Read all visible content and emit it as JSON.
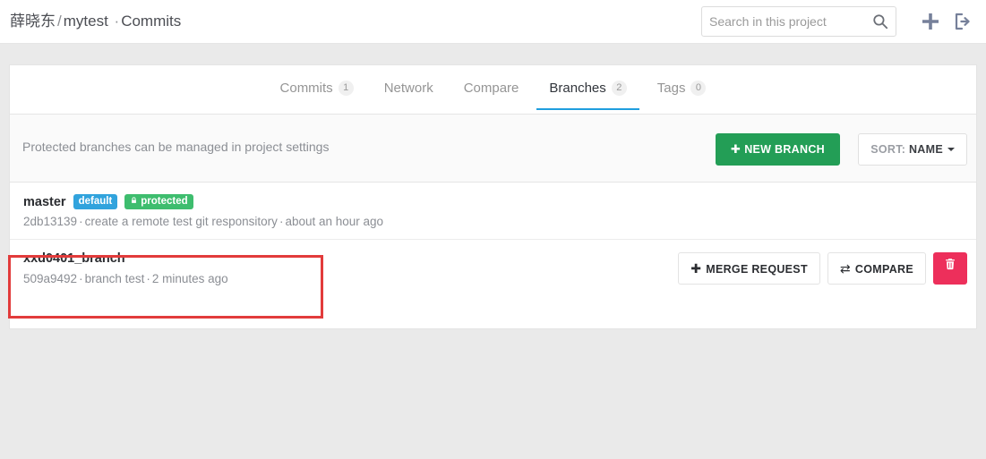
{
  "header": {
    "owner": "薛晓东",
    "separator": "/",
    "project": "mytest",
    "middot": "·",
    "page": "Commits",
    "search": {
      "placeholder": "Search in this project",
      "value": "",
      "icon": "search-icon"
    },
    "icons": {
      "plus": "plus-icon",
      "signout": "sign-out-icon"
    }
  },
  "tabs": [
    {
      "label": "Commits",
      "count": "1",
      "active": false
    },
    {
      "label": "Network",
      "count": "",
      "active": false
    },
    {
      "label": "Compare",
      "count": "",
      "active": false
    },
    {
      "label": "Branches",
      "count": "2",
      "active": true
    },
    {
      "label": "Tags",
      "count": "0",
      "active": false
    }
  ],
  "toolbar": {
    "protected_note_prefix": "Protected branches can be managed in ",
    "protected_note_link": "project settings",
    "new_branch_label": "NEW BRANCH",
    "new_branch_glyph": "✚",
    "sort_prefix": "SORT: ",
    "sort_value": "NAME"
  },
  "branches": [
    {
      "name": "master",
      "badges": [
        {
          "label": "default",
          "kind": "default"
        },
        {
          "label": "protected",
          "kind": "protected",
          "glyph": "🔒"
        }
      ],
      "sha": "2db13139",
      "message": "create a remote test git responsitory",
      "time": "about an hour ago",
      "actions": []
    },
    {
      "name": "xxd0401_branch",
      "badges": [],
      "sha": "509a9492",
      "message": "branch test",
      "time": "2 minutes ago",
      "actions": [
        {
          "label": "MERGE REQUEST",
          "glyph": "✚",
          "kind": "merge-request"
        },
        {
          "label": "COMPARE",
          "glyph": "⇄",
          "kind": "compare"
        },
        {
          "label": "",
          "glyph": "trash",
          "kind": "delete"
        }
      ]
    }
  ],
  "colors": {
    "page_background": "#eaeaea",
    "accent_blue": "#1f9ede",
    "green_button": "#239e56",
    "badge_default": "#31a3dd",
    "badge_protected": "#3ebd6e",
    "delete_red": "#ed2f5b",
    "annotation_red": "#e23b3b"
  },
  "annotation": {
    "shape": "rectangle",
    "target": "xxd0401_branch row"
  }
}
